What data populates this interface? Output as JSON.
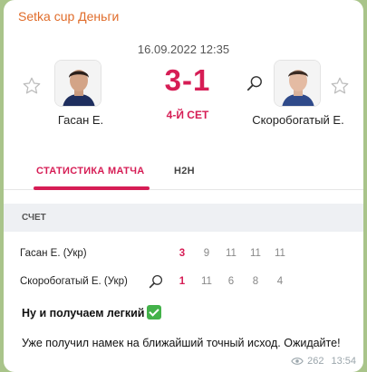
{
  "channel": {
    "title": "Setka cup Деньги"
  },
  "match": {
    "datetime": "16.09.2022 12:35",
    "score": "3-1",
    "set": "4-Й СЕТ",
    "player1": {
      "name": "Гасан Е."
    },
    "player2": {
      "name": "Скоробогатый Е."
    }
  },
  "tabs": {
    "stats": "СТАТИСТИКА МАТЧА",
    "h2h": "H2H"
  },
  "score_section": {
    "header": "СЧЕТ",
    "rows": [
      {
        "name": "Гасан Е. (Укр)",
        "total": "3",
        "sets": [
          "9",
          "11",
          "11",
          "11"
        ]
      },
      {
        "name": "Скоробогатый Е. (Укр)",
        "total": "1",
        "sets": [
          "11",
          "6",
          "8",
          "4"
        ]
      }
    ]
  },
  "message": {
    "line1": "Ну и получаем легкий",
    "line2": "Уже получил намек на ближайший точный исход. Ожидайте!"
  },
  "meta": {
    "views": "262",
    "time": "13:54"
  },
  "colors": {
    "accent": "#d61d55",
    "channel": "#e06c2a"
  },
  "icons": [
    "star-icon",
    "racket-icon",
    "check-icon",
    "eye-icon"
  ]
}
